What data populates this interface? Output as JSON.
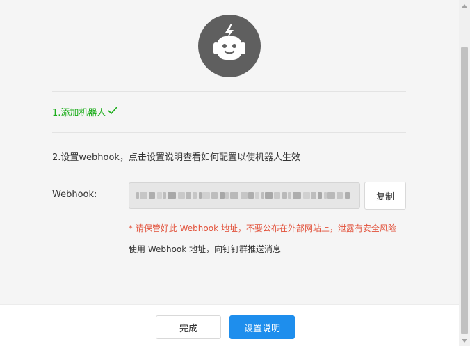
{
  "dialog": {
    "step1": {
      "label": "1.添加机器人"
    },
    "step2": {
      "label": "2.设置webhook，点击设置说明查看如何配置以使机器人生效"
    },
    "webhook": {
      "label": "Webhook:",
      "value_state": "blurred"
    },
    "copy_button": "复制",
    "warning": "* 请保管好此 Webhook 地址，不要公布在外部网站上，泄露有安全风险",
    "hint": "使用 Webhook 地址，向钉钉群推送消息"
  },
  "footer": {
    "done_button": "完成",
    "setup_button": "设置说明"
  },
  "colors": {
    "success": "#1aad19",
    "warning": "#e2513a",
    "primary": "#1e8eed",
    "avatar_bg": "#5f5f5f"
  },
  "icons": [
    "robot-icon",
    "check-icon",
    "scroll-up-arrow-icon",
    "scroll-down-arrow-icon"
  ]
}
